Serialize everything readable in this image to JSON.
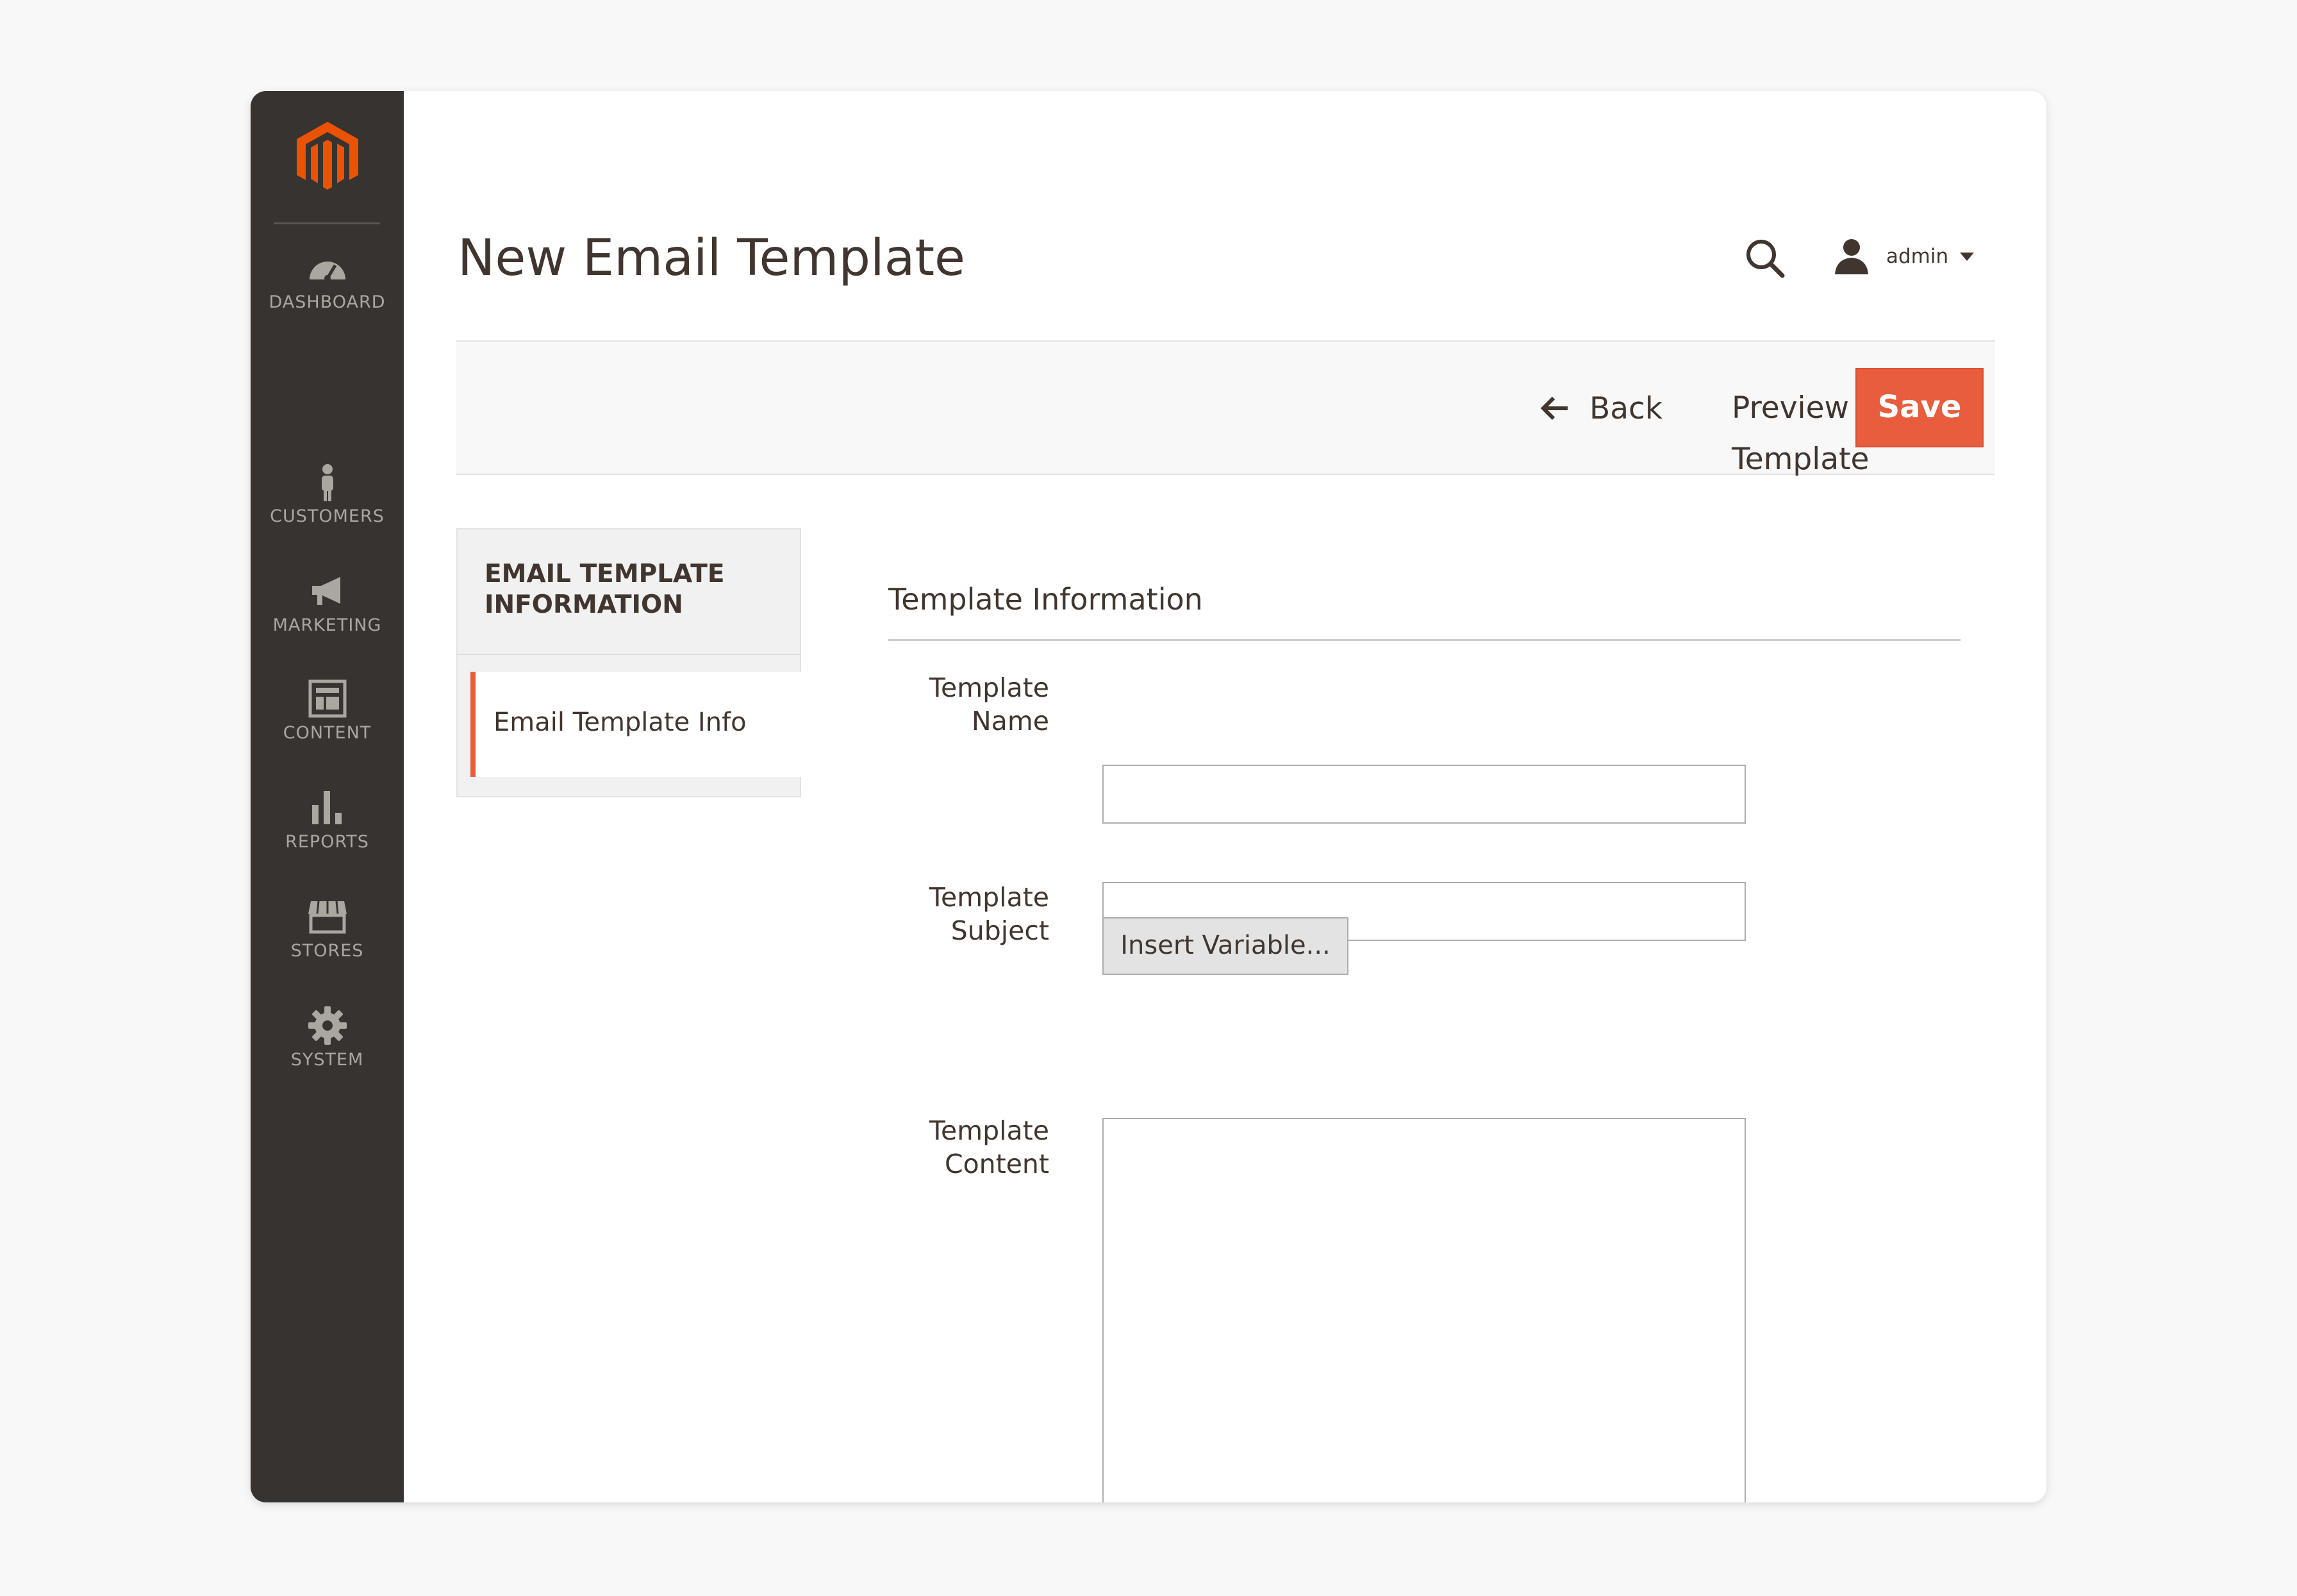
{
  "sidebar": {
    "logo": {
      "icon": "magento-logo-icon",
      "color": "#eb5202"
    },
    "items": [
      {
        "label": "DASHBOARD",
        "icon": "speedometer-icon"
      },
      {
        "label": "CUSTOMERS",
        "icon": "person-icon"
      },
      {
        "label": "MARKETING",
        "icon": "megaphone-icon"
      },
      {
        "label": "CONTENT",
        "icon": "layout-icon"
      },
      {
        "label": "REPORTS",
        "icon": "bar-chart-icon"
      },
      {
        "label": "STORES",
        "icon": "storefront-icon"
      },
      {
        "label": "SYSTEM",
        "icon": "gear-icon"
      }
    ]
  },
  "header": {
    "title": "New Email Template",
    "search_icon": "search-icon",
    "user": {
      "name": "admin",
      "icon": "user-icon"
    }
  },
  "actions": {
    "back_label": "Back",
    "preview_label": "Preview Template",
    "save_label": "Save",
    "save_color": "#e85d3d"
  },
  "tabs": {
    "title": "EMAIL TEMPLATE INFORMATION",
    "title_line1": "EMAIL TEMPLATE",
    "title_line2": "INFORMATION",
    "items": [
      {
        "label": "Email Template Info",
        "active": true
      }
    ]
  },
  "form": {
    "section_title": "Template Information",
    "fields": {
      "name": {
        "label_line1": "Template",
        "label_line2": "Name",
        "required": "*",
        "value": ""
      },
      "subject": {
        "label_line1": "Template",
        "label_line2": "Subject",
        "required": "*",
        "value": ""
      },
      "content": {
        "label_line1": "Template",
        "label_line2": "Content",
        "required": "*",
        "value": ""
      }
    },
    "insert_variable_label": "Insert Variable..."
  }
}
